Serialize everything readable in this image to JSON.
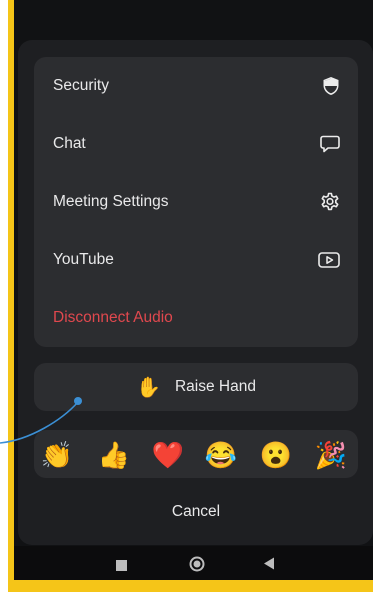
{
  "menu": {
    "items": [
      {
        "label": "Security",
        "icon": "shield-icon"
      },
      {
        "label": "Chat",
        "icon": "chat-bubble-icon"
      },
      {
        "label": "Meeting Settings",
        "icon": "gear-icon"
      },
      {
        "label": "YouTube",
        "icon": "youtube-icon"
      },
      {
        "label": "Disconnect Audio",
        "color": "#e0484e"
      }
    ]
  },
  "raise_hand": {
    "label": "Raise Hand",
    "emoji": "✋",
    "icon": "raised-hand-icon"
  },
  "reactions": [
    {
      "name": "clap",
      "emoji": "👏"
    },
    {
      "name": "thumbs-up",
      "emoji": "👍"
    },
    {
      "name": "heart",
      "emoji": "❤️"
    },
    {
      "name": "joy",
      "emoji": "😂"
    },
    {
      "name": "open-mouth",
      "emoji": "😮"
    },
    {
      "name": "tada",
      "emoji": "🎉"
    }
  ],
  "cancel_label": "Cancel",
  "colors": {
    "accent_frame": "#f5c518",
    "danger": "#e0484e",
    "annotation": "#3b8fd4"
  }
}
